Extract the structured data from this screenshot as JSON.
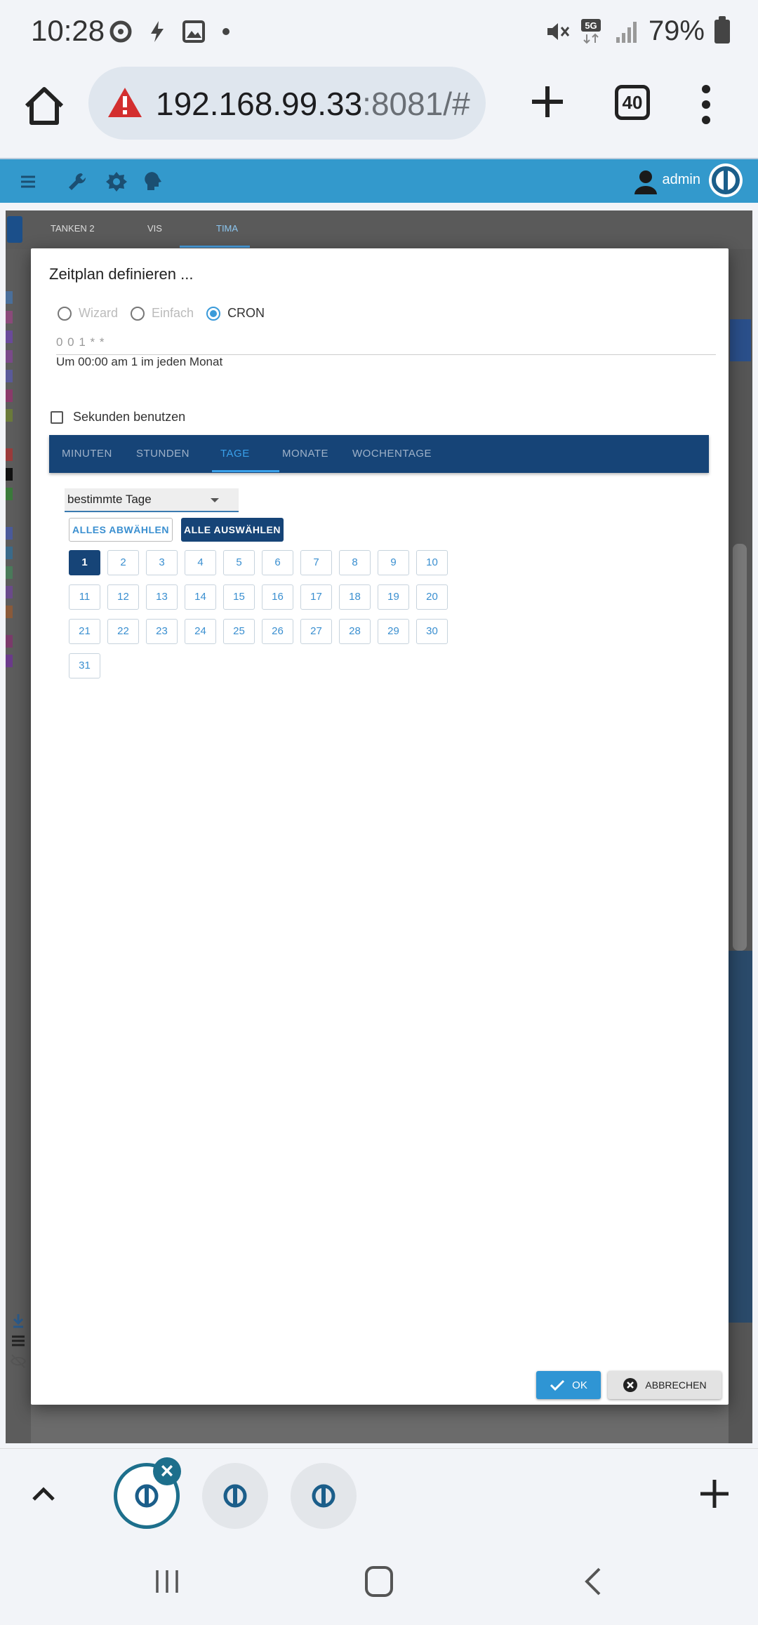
{
  "status_bar": {
    "time": "10:28",
    "battery": "79%"
  },
  "browser": {
    "url": "192.168.99.33",
    "url_port": ":8081/#",
    "tab_count": "40"
  },
  "app_header": {
    "user": "admin"
  },
  "bg_tabs": [
    "TANKEN 2",
    "VIS",
    "TIMA"
  ],
  "dialog": {
    "title": "Zeitplan definieren ...",
    "modes": [
      "Wizard",
      "Einfach",
      "CRON"
    ],
    "selected_mode": "CRON",
    "cron_expression": "0 0 1 * *",
    "cron_description": "Um 00:00 am 1 im jeden Monat",
    "seconds_label": "Sekunden benutzen",
    "tabs": [
      "MINUTEN",
      "STUNDEN",
      "TAGE",
      "MONATE",
      "WOCHENTAGE"
    ],
    "active_tab": "TAGE",
    "days_select": "bestimmte Tage",
    "deselect_all": "ALLES ABWÄHLEN",
    "select_all": "ALLE AUSWÄHLEN",
    "days": [
      "1",
      "2",
      "3",
      "4",
      "5",
      "6",
      "7",
      "8",
      "9",
      "10",
      "11",
      "12",
      "13",
      "14",
      "15",
      "16",
      "17",
      "18",
      "19",
      "20",
      "21",
      "22",
      "23",
      "24",
      "25",
      "26",
      "27",
      "28",
      "29",
      "30",
      "31"
    ],
    "selected_days": [
      "1"
    ],
    "ok_label": "OK",
    "cancel_label": "ABBRECHEN"
  },
  "colors": {
    "header": "#3399cc",
    "dark_blue": "#164477",
    "accent": "#3aa0ea"
  }
}
